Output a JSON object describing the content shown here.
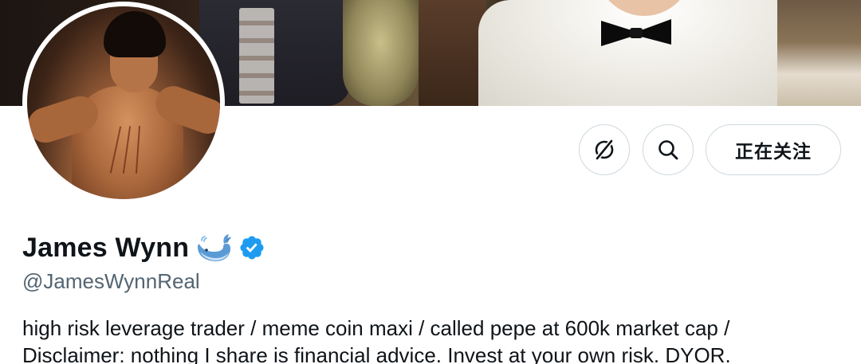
{
  "profile": {
    "display_name": "James Wynn",
    "handle": "@JamesWynnReal",
    "bio_line_1": "high risk leverage trader / meme coin maxi / called pepe at 600k market cap /",
    "bio_line_2": "Disclaimer: nothing I share is financial advice. Invest at your own risk. DYOR.",
    "name_emoji": "whale-emoji-icon",
    "verified": true
  },
  "actions": {
    "more_icon": "grok-slash-circle-icon",
    "search_icon": "search-icon",
    "follow_label": "正在关注"
  },
  "colors": {
    "verified_blue": "#1d9bf0",
    "text_primary": "#0f1419",
    "text_secondary": "#536471",
    "button_border": "#cfd9de"
  }
}
